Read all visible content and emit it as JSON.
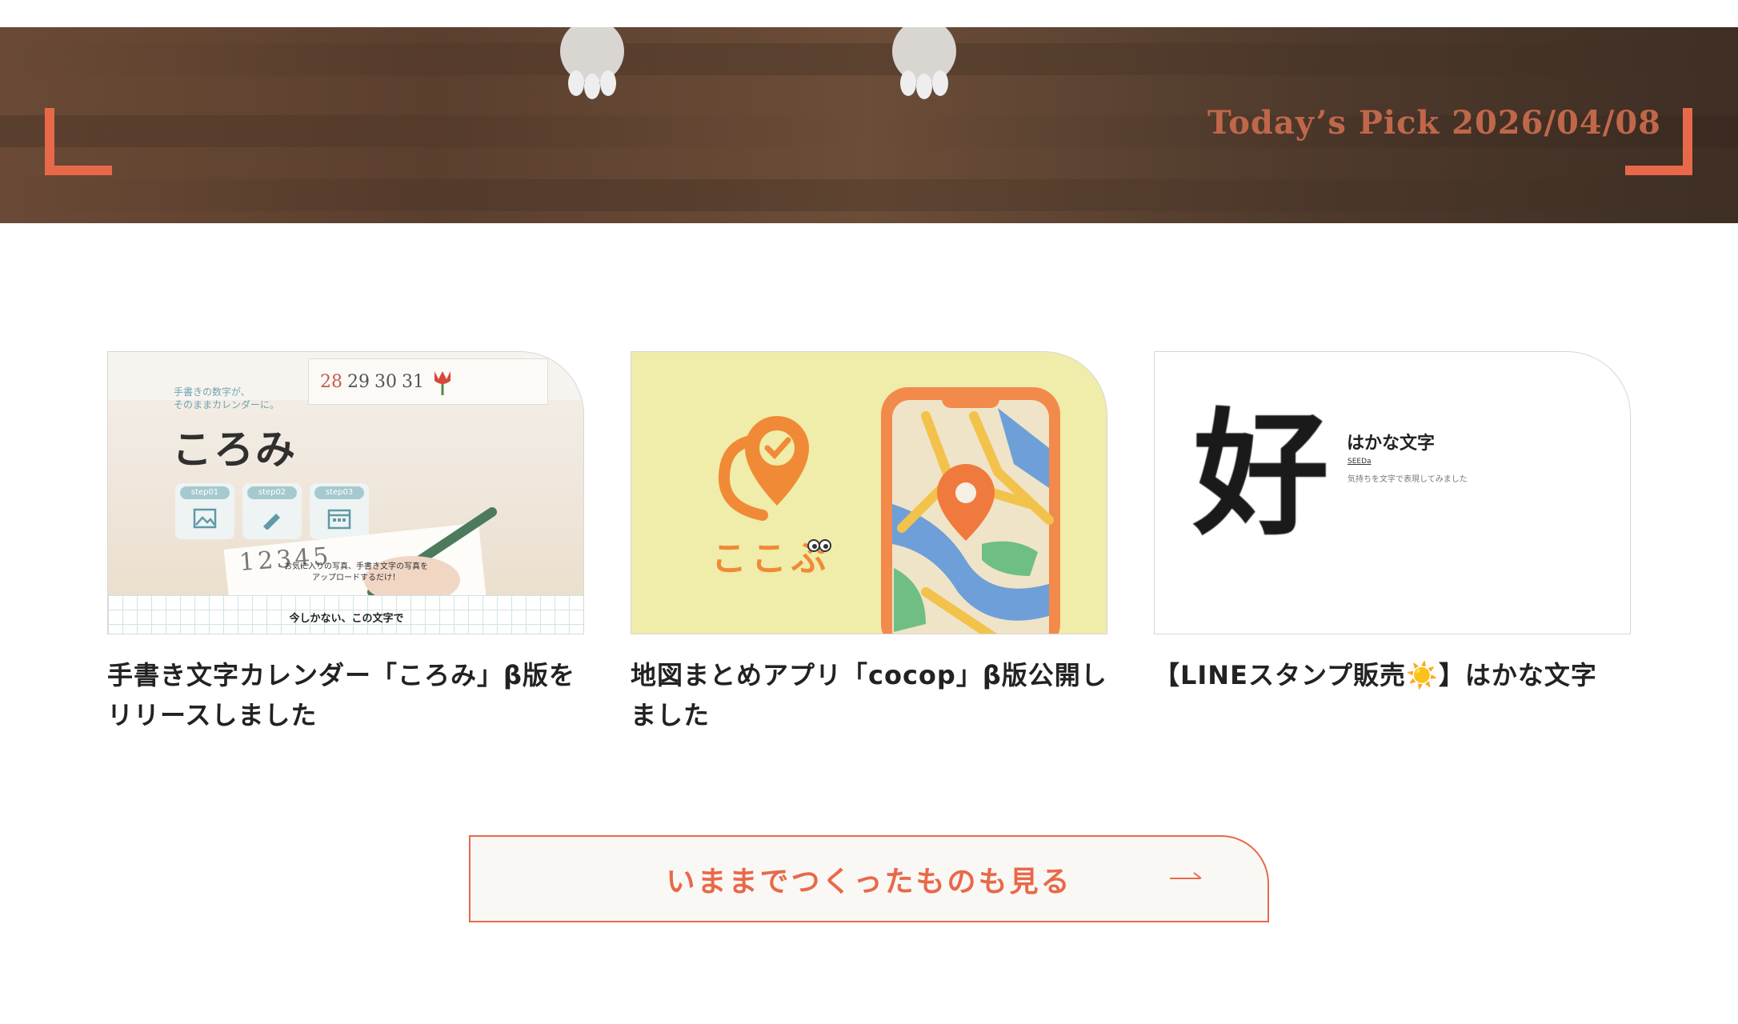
{
  "hero": {
    "pick_label": "Today’s Pick 2026/04/08",
    "accent_color": "#e8694a"
  },
  "cards": [
    {
      "title": "手書き文字カレンダー「ころみ」β版をリリースしました",
      "thumb": {
        "headline_small": "手書きの数字が、\nそのままカレンダーに。",
        "app_name": "ころみ",
        "calendar_numbers": [
          "28",
          "29",
          "30",
          "31"
        ],
        "steps": [
          "step01",
          "step02",
          "step03"
        ],
        "handwriting": "12345",
        "caption": "お気に入りの写真、手書き文字の写真を\nアップロードするだけ！",
        "footer_text": "今しかない、この文字で"
      }
    },
    {
      "title": "地図まとめアプリ「cocop」β版公開しました",
      "thumb": {
        "logo_text": "ここぷ",
        "bg_color": "#f0ecaa"
      }
    },
    {
      "title": "【LINEスタンプ販売☀️】はかな文字",
      "thumb": {
        "big_char": "好",
        "heading": "はかな文字",
        "author": "SEEDa",
        "description": "気持ちを文字で表現してみました"
      }
    }
  ],
  "cta": {
    "label": "いままでつくったものも見る",
    "arrow": "→"
  }
}
